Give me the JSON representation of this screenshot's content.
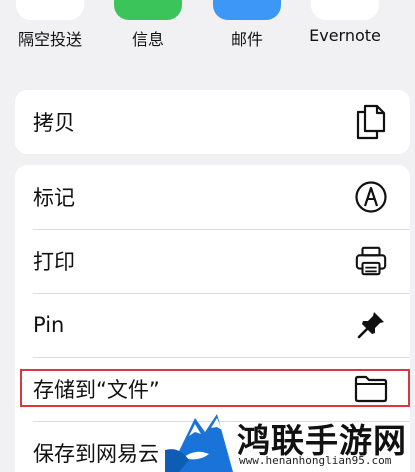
{
  "share_apps": [
    {
      "label": "隔空投送",
      "icon": "airdrop-icon",
      "color": "#2f8cf5"
    },
    {
      "label": "信息",
      "icon": "messages-icon",
      "color": "#3bc45a"
    },
    {
      "label": "邮件",
      "icon": "mail-icon",
      "color": "#2f8cf5"
    },
    {
      "label": "Evernote",
      "icon": "evernote-icon",
      "color": "#2dbe60"
    }
  ],
  "actions_group_1": [
    {
      "label": "拷贝",
      "icon": "copy-icon"
    }
  ],
  "actions_group_2": [
    {
      "label": "标记",
      "icon": "markup-icon"
    },
    {
      "label": "打印",
      "icon": "printer-icon"
    },
    {
      "label": "Pin",
      "icon": "pin-icon"
    },
    {
      "label": "存储到“文件”",
      "icon": "folder-icon"
    },
    {
      "label": "保存到网易云",
      "icon": "cloud-icon"
    }
  ],
  "highlight_color": "#d9363e",
  "watermark": {
    "title": "鸿联手游网",
    "url": "www.henanhonglian95.com"
  }
}
